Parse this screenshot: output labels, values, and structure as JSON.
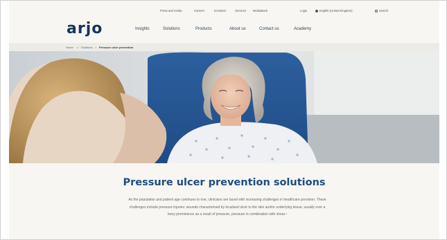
{
  "utility_nav": {
    "press": "Press and media",
    "careers": "Careers",
    "investors": "Investors",
    "service": "Services",
    "media_bank": "MediaBank",
    "login": "Login",
    "language": "English (United Kingdom)",
    "search": "Search"
  },
  "brand": {
    "logo": "arjo",
    "color": "#16345d"
  },
  "main_nav": [
    "Insights",
    "Solutions",
    "Products",
    "About us",
    "Contact us",
    "Academy"
  ],
  "breadcrumb": {
    "home": "Home",
    "solutions": "Solutions",
    "current": "Pressure ulcer prevention",
    "separator": ">"
  },
  "hero": {
    "alt_icon": "hero-photo"
  },
  "main": {
    "title": "Pressure ulcer prevention solutions",
    "body": "As the population and patient age continues to rise, clinicians are faced with increasing challenges in healthcare provision. These challenges include pressure injuries: wounds characterised by localised ulcer to the skin and/or underlying tissue, usually over a bony prominence as a result of pressure, pressure in combination with shear.¹"
  },
  "colors": {
    "title": "#1d4e80",
    "page_bg": "#f7f6f2",
    "breadcrumb_bg": "#ecebe6"
  }
}
